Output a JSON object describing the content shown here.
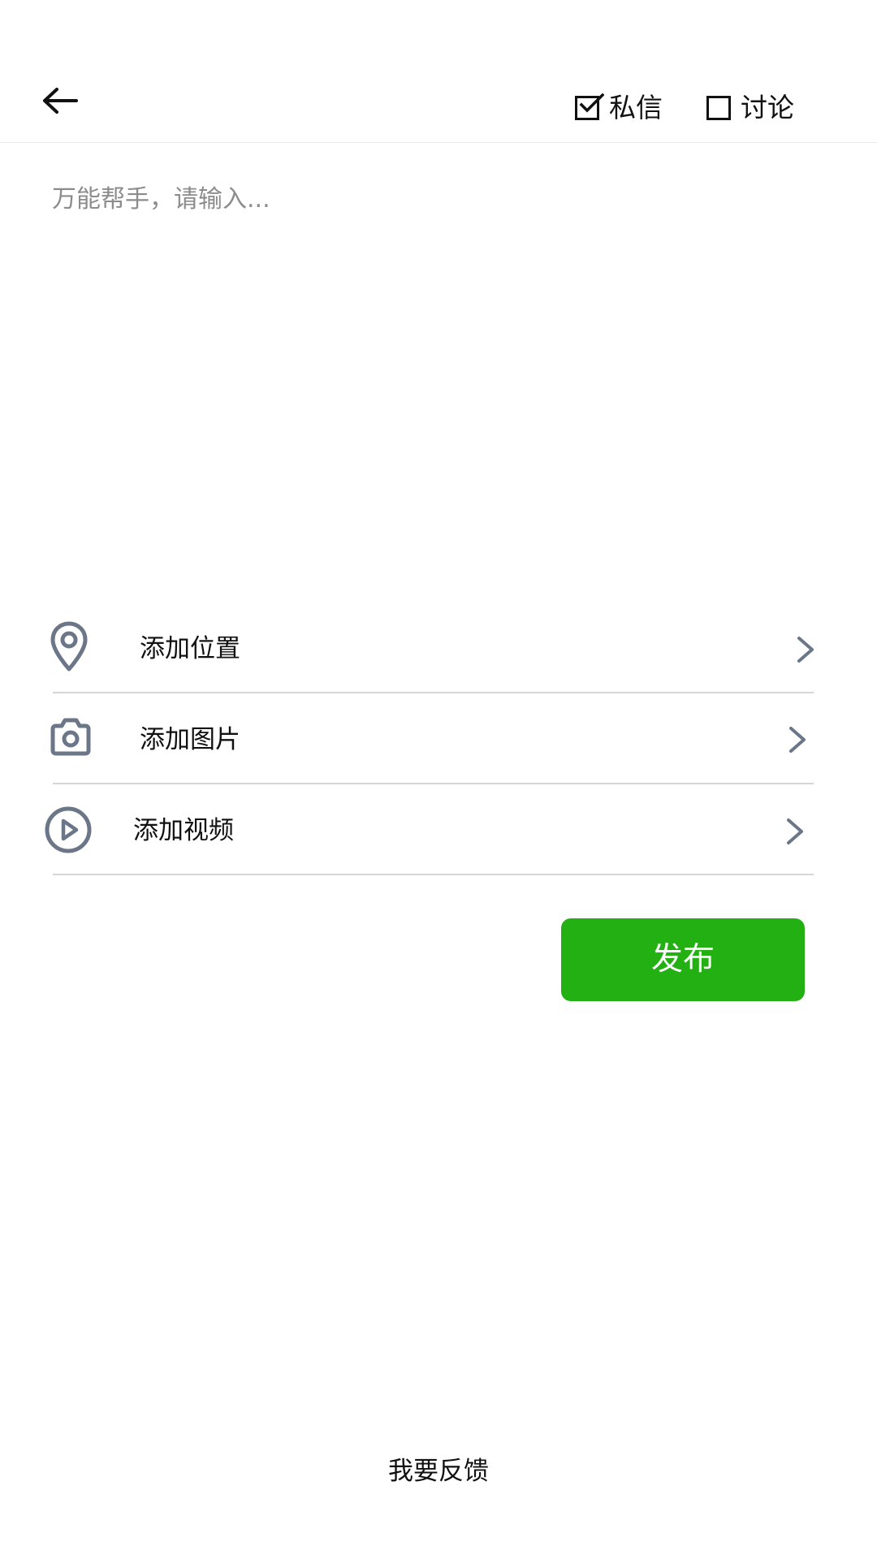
{
  "header": {
    "back_icon": "arrow-left-icon",
    "private_message": {
      "label": "私信",
      "checked": true
    },
    "discussion": {
      "label": "讨论",
      "checked": false
    }
  },
  "compose": {
    "placeholder": "万能帮手，请输入...",
    "value": ""
  },
  "options": [
    {
      "label": "添加位置",
      "icon": "location-pin-icon",
      "chevron": "chevron-right-icon"
    },
    {
      "label": "添加图片",
      "icon": "camera-icon",
      "chevron": "chevron-right-icon"
    },
    {
      "label": "添加视频",
      "icon": "play-circle-icon",
      "chevron": "chevron-right-icon"
    }
  ],
  "publish": {
    "label": "发布"
  },
  "feedback": {
    "label": "我要反馈"
  },
  "colors": {
    "accent": "#22b012",
    "icon": "#6b7788",
    "divider": "#d6d6d6",
    "placeholder": "#8c8c8c"
  }
}
